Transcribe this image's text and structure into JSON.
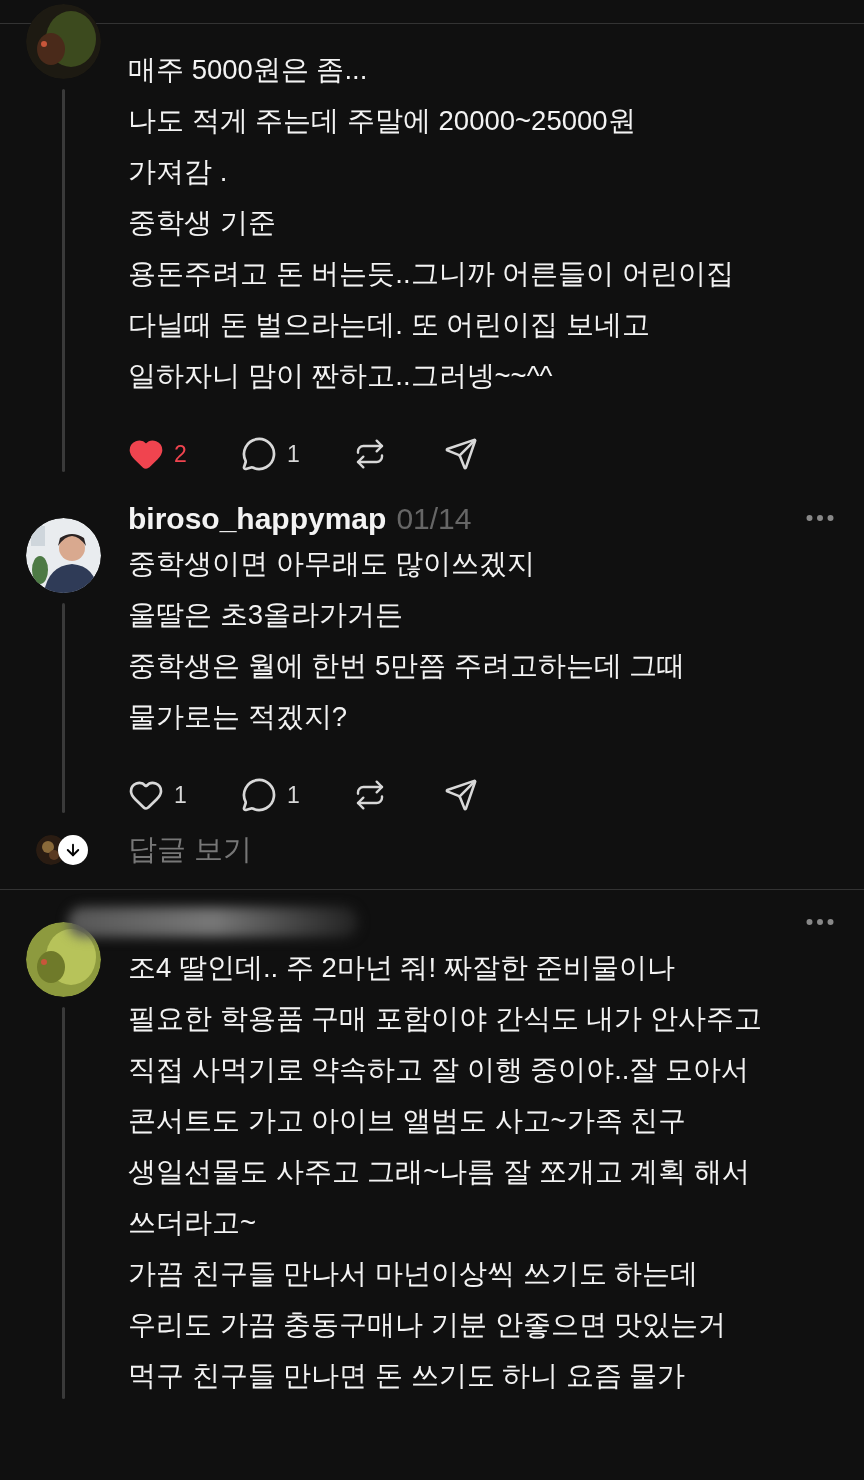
{
  "posts": [
    {
      "body": "매주 5000원은 좀...\n나도 적게 주는데 주말에 20000~25000원\n가져감 .\n중학생 기준\n용돈주려고 돈 버는듯..그니까 어른들이 어린이집\n다닐때 돈 벌으라는데. 또 어린이집 보네고\n일하자니 맘이 짠하고..그러넹~~^^",
      "actions": {
        "liked": true,
        "likes": "2",
        "replies": "1"
      }
    },
    {
      "username": "biroso_happymap",
      "date": "01/14",
      "body": "중학생이면 아무래도 많이쓰겠지\n울딸은 초3올라가거든\n중학생은 월에 한번 5만쯤 주려고하는데 그때\n물가로는 적겠지?",
      "actions": {
        "liked": false,
        "likes": "1",
        "replies": "1"
      },
      "view_replies": "답글 보기"
    },
    {
      "body": "조4 딸인데.. 주 2마넌 줘! 짜잘한 준비물이나\n필요한 학용품 구매 포함이야 간식도 내가 안사주고\n직접 사먹기로 약속하고 잘 이행 중이야..잘 모아서\n콘서트도 가고 아이브 앨범도 사고~가족 친구\n생일선물도 사주고 그래~나름 잘 쪼개고 계획 해서\n쓰더라고~\n가끔 친구들 만나서 마넌이상씩 쓰기도 하는데\n우리도 가끔 충동구매나 기분 안좋으면 맛있는거\n먹구 친구들 만나면 돈 쓰기도 하니 요즘 물가"
    }
  ]
}
